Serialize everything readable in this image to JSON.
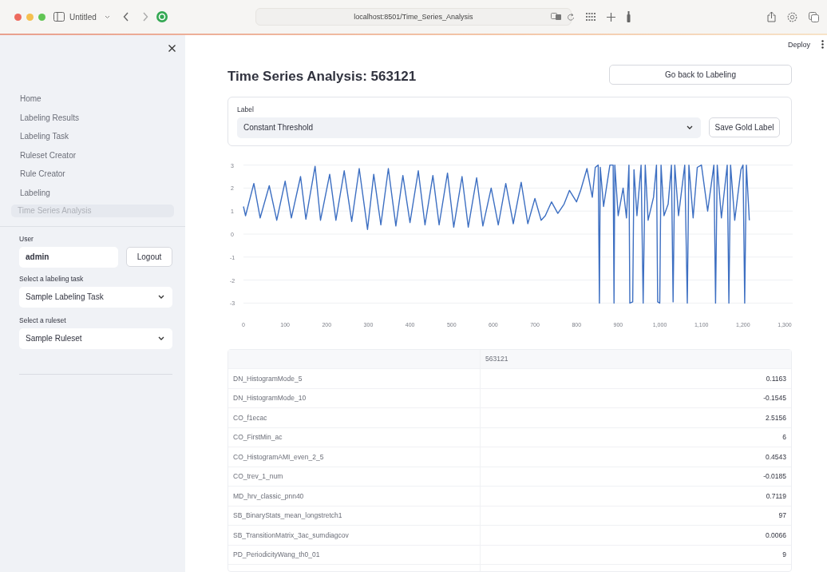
{
  "browser": {
    "tab_title": "Untitled",
    "url": "localhost:8501/Time_Series_Analysis"
  },
  "sidebar": {
    "nav": [
      {
        "label": "Home",
        "selected": false
      },
      {
        "label": "Labeling Results",
        "selected": false
      },
      {
        "label": "Labeling Task",
        "selected": false
      },
      {
        "label": "Ruleset Creator",
        "selected": false
      },
      {
        "label": "Rule Creator",
        "selected": false
      },
      {
        "label": "Labeling",
        "selected": false
      },
      {
        "label": "Time Series Analysis",
        "selected": true
      }
    ],
    "user_label": "User",
    "user_value": "admin",
    "logout": "Logout",
    "task_label": "Select a labeling task",
    "task_value": "Sample Labeling Task",
    "ruleset_label": "Select a ruleset",
    "ruleset_value": "Sample Ruleset"
  },
  "header": {
    "deploy": "Deploy"
  },
  "title": "Time Series Analysis: 563121",
  "back_button": "Go back to Labeling",
  "label_form": {
    "label": "Label",
    "value": "Constant Threshold",
    "save_button": "Save Gold Label"
  },
  "chart_data": {
    "type": "line",
    "x": [
      0,
      5,
      25,
      40,
      62,
      80,
      100,
      115,
      137,
      150,
      172,
      185,
      207,
      222,
      242,
      260,
      278,
      298,
      313,
      330,
      348,
      366,
      383,
      400,
      420,
      436,
      455,
      470,
      490,
      505,
      525,
      540,
      560,
      575,
      595,
      612,
      630,
      648,
      667,
      683,
      700,
      715,
      725,
      740,
      755,
      770,
      783,
      800,
      810,
      825,
      838,
      845,
      852,
      855,
      857,
      865,
      880,
      888,
      890,
      892,
      900,
      912,
      920,
      926,
      928,
      935,
      938,
      945,
      955,
      960,
      965,
      972,
      985,
      992,
      995,
      1000,
      1003,
      1010,
      1020,
      1028,
      1032,
      1036,
      1045,
      1060,
      1066,
      1070,
      1080,
      1090,
      1100,
      1115,
      1130,
      1134,
      1138,
      1148,
      1162,
      1166,
      1170,
      1180,
      1195,
      1200,
      1204,
      1208,
      1215
    ],
    "series": [
      {
        "color": "#3d6fc2",
        "values": [
          1.2,
          0.8,
          2.2,
          0.7,
          2.1,
          0.6,
          2.3,
          0.7,
          2.5,
          0.65,
          2.95,
          0.6,
          2.6,
          0.6,
          2.75,
          0.55,
          2.85,
          0.2,
          2.6,
          0.4,
          2.85,
          0.35,
          2.55,
          0.5,
          2.75,
          0.4,
          2.55,
          0.4,
          2.65,
          0.3,
          2.5,
          0.3,
          2.45,
          0.35,
          2.0,
          0.4,
          2.2,
          0.45,
          2.25,
          0.45,
          1.55,
          0.6,
          0.8,
          1.4,
          0.9,
          1.3,
          1.9,
          1.4,
          1.9,
          2.85,
          1.6,
          2.9,
          3.0,
          -3.0,
          2.9,
          1.2,
          3.0,
          3.0,
          -3.0,
          3.0,
          0.8,
          2.0,
          0.7,
          3.0,
          -3.0,
          -2.95,
          2.8,
          0.8,
          3.0,
          -3.0,
          3.0,
          0.6,
          1.6,
          3.0,
          -2.95,
          -3.0,
          3.0,
          0.8,
          1.3,
          3.0,
          -2.95,
          3.0,
          0.8,
          3.0,
          -3.0,
          3.0,
          0.7,
          2.9,
          3.0,
          1.0,
          3.0,
          -3.0,
          3.0,
          0.7,
          3.0,
          -3.0,
          3.0,
          0.6,
          2.8,
          3.0,
          -3.0,
          3.0,
          0.6
        ]
      }
    ],
    "xlim": [
      0,
      1300
    ],
    "ylim": [
      -3,
      3
    ],
    "grid": true,
    "xticks": [
      0,
      100,
      200,
      300,
      400,
      500,
      600,
      700,
      800,
      900,
      {
        "value": 1000,
        "label": "1,000"
      },
      {
        "value": 1100,
        "label": "1,100"
      },
      {
        "value": 1200,
        "label": "1,200"
      },
      {
        "value": 1300,
        "label": "1,300"
      }
    ],
    "yticks": [
      -3,
      -2,
      -1,
      0,
      1,
      2,
      3
    ]
  },
  "table": {
    "header": "563121",
    "rows": [
      {
        "feature": "DN_HistogramMode_5",
        "value": "0.1163"
      },
      {
        "feature": "DN_HistogramMode_10",
        "value": "-0.1545"
      },
      {
        "feature": "CO_f1ecac",
        "value": "2.5156"
      },
      {
        "feature": "CO_FirstMin_ac",
        "value": "6"
      },
      {
        "feature": "CO_HistogramAMI_even_2_5",
        "value": "0.4543"
      },
      {
        "feature": "CO_trev_1_num",
        "value": "-0.0185"
      },
      {
        "feature": "MD_hrv_classic_pnn40",
        "value": "0.7119"
      },
      {
        "feature": "SB_BinaryStats_mean_longstretch1",
        "value": "97"
      },
      {
        "feature": "SB_TransitionMatrix_3ac_sumdiagcov",
        "value": "0.0066"
      },
      {
        "feature": "PD_PeriodicityWang_th0_01",
        "value": "9"
      }
    ]
  }
}
